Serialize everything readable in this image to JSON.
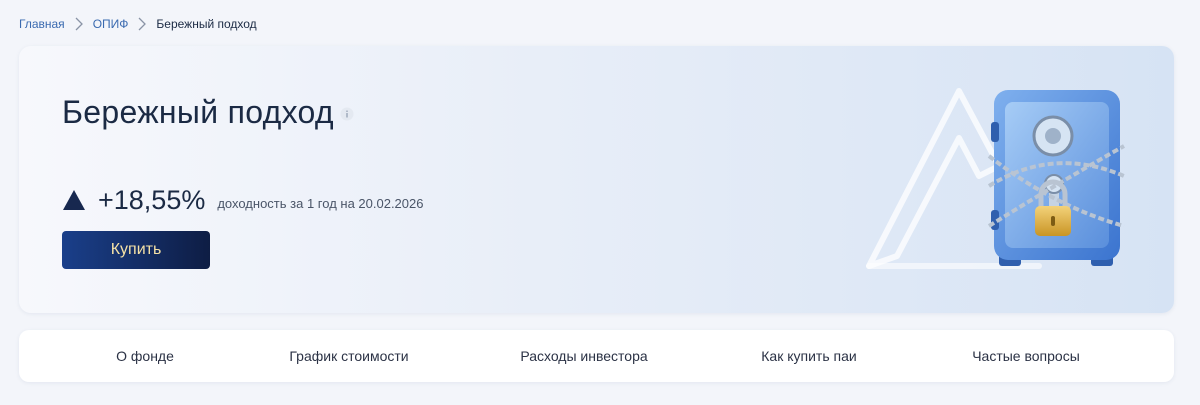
{
  "breadcrumb": {
    "items": [
      "Главная",
      "ОПИФ"
    ],
    "current": "Бережный подход"
  },
  "hero": {
    "title": "Бережный подход",
    "yield_value": "+18,55%",
    "yield_caption": "доходность за 1 год на 20.02.2026",
    "buy_label": "Купить"
  },
  "nav": {
    "tabs": [
      "О фонде",
      "График стоимости",
      "Расходы инвестора",
      "Как купить паи",
      "Частые вопросы"
    ]
  },
  "icons": {
    "info": "info-icon",
    "yield": "triangle-up-icon",
    "separator": "chevron-right-icon",
    "illustration": "safe-illustration"
  },
  "colors": {
    "accent": "#1a3f8a",
    "button_text": "#f5e2a6",
    "link": "#3a6ab0"
  }
}
